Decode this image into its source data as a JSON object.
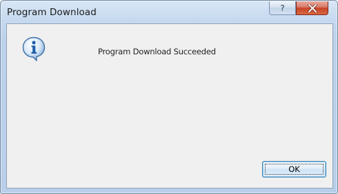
{
  "dialog": {
    "title": "Program Download",
    "help_glyph": "?",
    "close_icon": "close-icon",
    "help_icon": "help-icon"
  },
  "message": {
    "icon": "info-icon",
    "text": "Program Download Succeeded"
  },
  "buttons": {
    "ok_label": "OK"
  },
  "colors": {
    "frame": "#c5d8ee",
    "close_button": "#c7432a",
    "client_bg": "#f0f0f0",
    "info_icon": "#2c6fb6"
  }
}
